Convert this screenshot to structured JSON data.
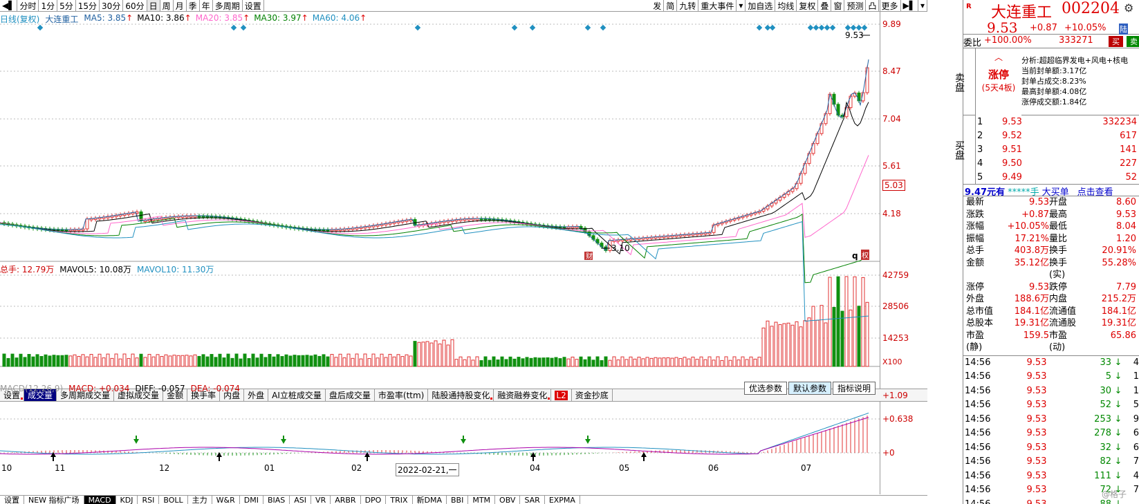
{
  "toolbar": {
    "nav_left": "◀▌",
    "nav_right": "▶",
    "periods": [
      "分时",
      "1分",
      "5分",
      "15分",
      "30分",
      "60分",
      "日",
      "周",
      "月",
      "季",
      "年",
      "多周期",
      "设置"
    ],
    "selected_period": "日",
    "right": [
      "发",
      "简",
      "九转",
      "重大事件",
      "▾",
      "加自选",
      "均线",
      "复权",
      "叠",
      "窗",
      "预测",
      "凸",
      "更多",
      "▶▌",
      "▾"
    ]
  },
  "main_legend": {
    "prefix": "日线(复权)",
    "name": "大连重工",
    "items": [
      {
        "label": "MA5: 3.85",
        "color": "#2060a0"
      },
      {
        "label": "MA10: 3.86",
        "color": "#000000"
      },
      {
        "label": "MA20: 3.85",
        "color": "#ff66cc"
      },
      {
        "label": "MA30: 3.97",
        "color": "#008000"
      },
      {
        "label": "MA60: 4.06",
        "color": "#2090c0"
      }
    ]
  },
  "main_axis": [
    "9.89",
    "8.47",
    "7.04",
    "5.61",
    "5.03",
    "4.18"
  ],
  "annotations": {
    "high": "9.53",
    "low": "3.10",
    "cai": "财",
    "q": "q",
    "ban": "权"
  },
  "vol_legend": {
    "items": [
      {
        "label": "总手: 12.79万",
        "color": "#cc0000"
      },
      {
        "label": "MAVOL5: 10.08万",
        "color": "#000000"
      },
      {
        "label": "MAVOL10: 11.30万",
        "color": "#2090c0"
      }
    ]
  },
  "vol_axis": [
    "42759",
    "28506",
    "14253",
    "X100"
  ],
  "mid_tabs": [
    "设置",
    "成交量",
    "多周期成交量",
    "虚拟成交量",
    "金额",
    "换手率",
    "内盘",
    "外盘",
    "AI立桩成交量",
    "盘后成交量",
    "市盈率(ttm)",
    "陆股通持股变化",
    "融资融券变化",
    "L2",
    "资金抄底"
  ],
  "mid_tab_selected": "成交量",
  "macd_legend": {
    "prefix": "MACD(12,26,9)",
    "items": [
      {
        "label": "MACD: +0.034",
        "color": "#cc0000"
      },
      {
        "label": "DIFF: -0.057",
        "color": "#000000"
      },
      {
        "label": "DEA: -0.074",
        "color": "#cc0000"
      }
    ]
  },
  "macd_buttons": [
    "优选参数",
    "默认参数",
    "指标说明"
  ],
  "macd_button_selected": "默认参数",
  "macd_axis": [
    "+1.09",
    "+0.638",
    "+0"
  ],
  "x_axis": [
    {
      "label": "10",
      "pos": 0
    },
    {
      "label": "11",
      "pos": 77
    },
    {
      "label": "12",
      "pos": 228
    },
    {
      "label": "01",
      "pos": 380
    },
    {
      "label": "02",
      "pos": 506
    },
    {
      "label": "2022-02-21,一",
      "pos": 570
    },
    {
      "label": "04",
      "pos": 764
    },
    {
      "label": "05",
      "pos": 893
    },
    {
      "label": "06",
      "pos": 1022
    },
    {
      "label": "07",
      "pos": 1156
    }
  ],
  "bottom_tabs": [
    "设置",
    "NEW 指标广场",
    "MACD",
    "KDJ",
    "RSI",
    "BOLL",
    "主力",
    "W&R",
    "DMI",
    "BIAS",
    "ASI",
    "VR",
    "ARBR",
    "DPO",
    "TRIX",
    "新DMA",
    "BBI",
    "MTM",
    "OBV",
    "SAR",
    "EXPMA"
  ],
  "bottom_tab_selected": "MACD",
  "quote": {
    "mark": "R",
    "name": "大连重工",
    "code": "002204",
    "price": "9.53",
    "change": "+0.87",
    "pct": "+10.05%",
    "lu": "陆",
    "gear": "⚙",
    "weibi_label": "委比",
    "weibi": "+100.00%",
    "weibi_vol": "333271",
    "buy_btn": "买",
    "sell_btn": "卖",
    "sell_side": "卖盘",
    "buy_side": "买盘",
    "limit_title": "涨停",
    "limit_sub": "(5天4板)",
    "limit_info": [
      "分析:超超临界发电+风电+核电",
      "当前封单额:3.17亿",
      "封单占成交:8.23%",
      "最高封单额:4.08亿",
      "涨停成交额:1.84亿"
    ],
    "bids": [
      {
        "n": "1",
        "p": "9.53",
        "v": "332234"
      },
      {
        "n": "2",
        "p": "9.52",
        "v": "617"
      },
      {
        "n": "3",
        "p": "9.51",
        "v": "141"
      },
      {
        "n": "4",
        "p": "9.50",
        "v": "227"
      },
      {
        "n": "5",
        "p": "9.49",
        "v": "52"
      }
    ],
    "bigorder": {
      "a": "9.47元有",
      "b": "*****手",
      "c": "大买单",
      "d": "点击查看"
    },
    "stats": [
      [
        "最新",
        "9.53",
        "开盘",
        "8.60"
      ],
      [
        "涨跌",
        "+0.87",
        "最高",
        "9.53"
      ],
      [
        "涨幅",
        "+10.05%",
        "最低",
        "8.04"
      ],
      [
        "振幅",
        "17.21%",
        "量比",
        "1.20"
      ],
      [
        "总手",
        "403.8万",
        "换手",
        "20.91%"
      ],
      [
        "金额",
        "35.12亿",
        "换手(实)",
        "55.28%"
      ],
      [
        "涨停",
        "9.53",
        "跌停",
        "7.79"
      ],
      [
        "外盘",
        "188.6万",
        "内盘",
        "215.2万"
      ],
      [
        "总市值",
        "184.1亿",
        "流通值",
        "184.1亿"
      ],
      [
        "总股本",
        "19.31亿",
        "流通股",
        "19.31亿"
      ],
      [
        "市盈(静)",
        "159.5",
        "市盈(动)",
        "65.86"
      ]
    ],
    "ticks": [
      [
        "14:56",
        "9.53",
        "33",
        "↓",
        "4"
      ],
      [
        "14:56",
        "9.53",
        "5",
        "↓",
        "1"
      ],
      [
        "14:56",
        "9.53",
        "30",
        "↓",
        "1"
      ],
      [
        "14:56",
        "9.53",
        "52",
        "↓",
        "5"
      ],
      [
        "14:56",
        "9.53",
        "253",
        "↓",
        "9"
      ],
      [
        "14:56",
        "9.53",
        "278",
        "↓",
        "6"
      ],
      [
        "14:56",
        "9.53",
        "32",
        "↓",
        "6"
      ],
      [
        "14:56",
        "9.53",
        "82",
        "↓",
        "7"
      ],
      [
        "14:56",
        "9.53",
        "111",
        "↓",
        "4"
      ],
      [
        "14:56",
        "9.53",
        "72",
        "↓",
        "7"
      ],
      [
        "14:56",
        "9.53",
        "88",
        "↓",
        ""
      ]
    ],
    "watermark": "@格子"
  }
}
